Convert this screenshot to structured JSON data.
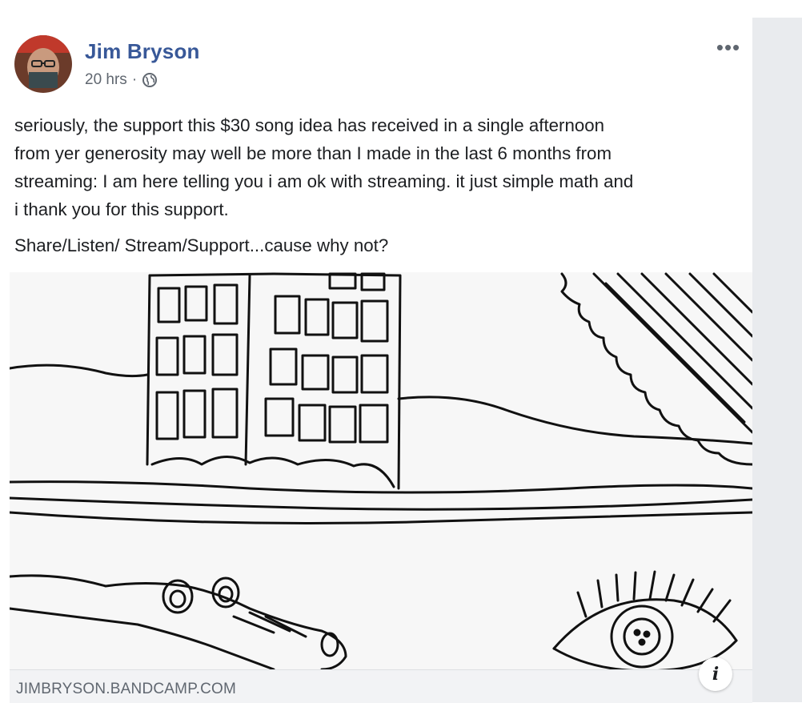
{
  "post": {
    "author": "Jim Bryson",
    "timestamp": "20 hrs",
    "separator": "·",
    "privacy_icon": "globe-icon",
    "more_label": "•••",
    "text_lines": [
      "seriously, the support this $30 song idea has received in a single afternoon",
      "from yer generosity may well be more than I made in the last 6 months from",
      "streaming: I am here telling you i am ok with streaming. it just simple math and",
      "i thank you for this support."
    ],
    "text_second": "Share/Listen/ Stream/Support...cause why not?"
  },
  "attachment": {
    "domain": "JIMBRYSON.BANDCAMP.COM",
    "info_label": "i",
    "image_icon": "line-drawing-illustration"
  },
  "colors": {
    "author_link": "#385898",
    "secondary_text": "#606770",
    "rail_background": "#e9ebee",
    "link_bar_background": "#f2f3f5"
  }
}
